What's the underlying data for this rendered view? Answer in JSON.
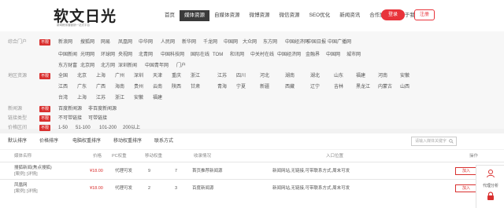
{
  "brand": {
    "title": "软文日光",
    "tagline": "新闻稿传播营销一站式平台",
    "accent": "#d9302f"
  },
  "nav": {
    "items": [
      "首页",
      "媒体资源",
      "自媒体资源",
      "微博资源",
      "微信资源",
      "SEO优化",
      "新闻资讯",
      "合作加盟",
      "关于我们"
    ],
    "active_index": 1
  },
  "auth": {
    "login": "登录",
    "register": "注册"
  },
  "filters": {
    "all_label": "不限",
    "rows": [
      {
        "label": "综合门户",
        "options": [
          [
            "新浪网",
            "搜狐网",
            "网易",
            "凤凰网",
            "中华网",
            "人民网",
            "新华网",
            "千龙网",
            "中国网",
            "大众网",
            "东方网",
            "中国经济网",
            "中国日报",
            "中国广播网"
          ],
          [
            "中国新闻",
            "光明网",
            "环球网",
            "央视网",
            "北青网",
            "中国科技网",
            "国际在线",
            "TOM",
            "和讯网",
            "中关村在线",
            "中国经济网",
            "金融界",
            "中国网",
            "城市网"
          ],
          [
            "东方财富",
            "北京网",
            "北方网",
            "深圳新闻",
            "中国青年网",
            "门户"
          ]
        ]
      },
      {
        "label": "地区资源",
        "options": [
          [
            "全国",
            "北京",
            "上海",
            "广州",
            "深圳",
            "天津",
            "重庆",
            "浙江",
            "江苏",
            "四川",
            "河北",
            "湖南",
            "湖北",
            "山东",
            "福建",
            "河南",
            "安徽"
          ],
          [
            "江西",
            "广东",
            "广西",
            "海南",
            "贵州",
            "云南",
            "陕西",
            "甘肃",
            "青海",
            "宁夏",
            "新疆",
            "西藏",
            "辽宁",
            "吉林",
            "黑龙江",
            "内蒙古",
            "山西"
          ],
          [
            "台湾",
            "上海",
            "江苏",
            "浙江",
            "安徽",
            "福建"
          ]
        ]
      },
      {
        "label": "新闻源",
        "options": [
          [
            "百度新闻源",
            "非百度新闻源"
          ]
        ]
      },
      {
        "label": "链接类型",
        "options": [
          [
            "不可带链接",
            "可带链接"
          ]
        ]
      },
      {
        "label": "价格区间",
        "options": [
          [
            "1-50",
            "51-100",
            "101-200",
            "200以上"
          ]
        ]
      }
    ]
  },
  "tabs": {
    "items": [
      "默认排序",
      "价格排序",
      "电脑权重排序",
      "移动权重排序",
      "联系方式"
    ],
    "search_placeholder": "请输入媒体关键字"
  },
  "table": {
    "headers": [
      "媒体名称",
      "价格",
      "PC权重",
      "移动权重",
      "收录情况",
      "入口位置",
      "备注",
      "操作"
    ],
    "rows": [
      {
        "name": "搜狐新闻(焦点搜狐)",
        "links": "[案例] [详情]",
        "price": "¥18.00",
        "pc": "代理可发",
        "pc_weight": "9",
        "mobile_weight": "7",
        "entry": "首页推荐新闻源",
        "note": "新闻网站,无链接,可带联系方式,周末可发",
        "buy": "加入"
      },
      {
        "name": "凤凰网",
        "links": "[案例] [详情]",
        "price": "¥18.00",
        "pc": "代理可发",
        "pc_weight": "2",
        "mobile_weight": "3",
        "entry": "百度新闻源",
        "note": "新闻网站,无链接,可带联系方式,周末可发",
        "buy": "加入"
      }
    ]
  },
  "float_widget": {
    "label": "代理分析"
  }
}
